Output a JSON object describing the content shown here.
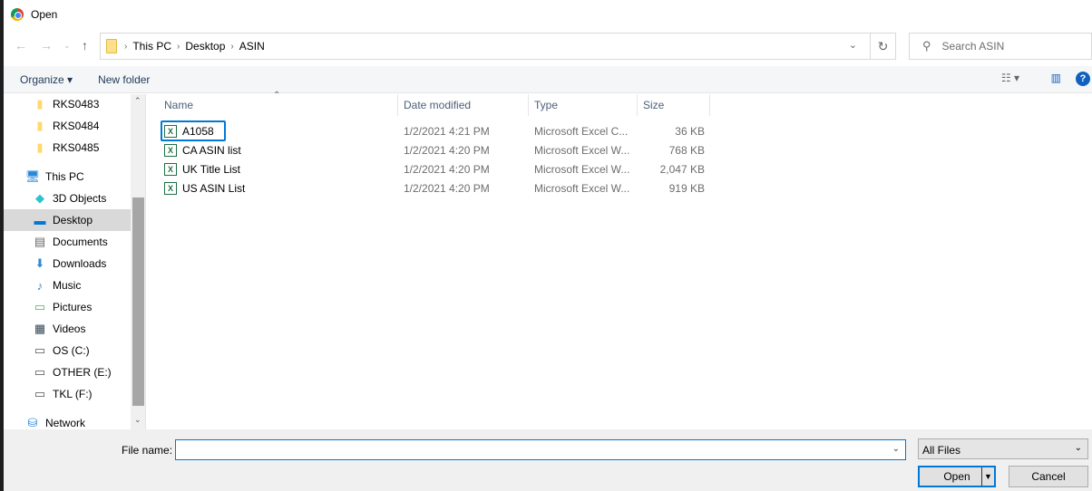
{
  "window": {
    "title": "Open"
  },
  "nav": {
    "breadcrumb": [
      "This PC",
      "Desktop",
      "ASIN"
    ],
    "search_placeholder": "Search ASIN"
  },
  "toolbar": {
    "organize": "Organize",
    "new_folder": "New folder"
  },
  "sidebar": {
    "items": [
      {
        "label": "RKS0483",
        "icon": "folder-icon"
      },
      {
        "label": "RKS0484",
        "icon": "folder-icon"
      },
      {
        "label": "RKS0485",
        "icon": "folder-icon"
      },
      {
        "label": "This PC",
        "icon": "computer-icon"
      },
      {
        "label": "3D Objects",
        "icon": "cube-icon"
      },
      {
        "label": "Desktop",
        "icon": "desktop-icon"
      },
      {
        "label": "Documents",
        "icon": "document-icon"
      },
      {
        "label": "Downloads",
        "icon": "download-icon"
      },
      {
        "label": "Music",
        "icon": "music-icon"
      },
      {
        "label": "Pictures",
        "icon": "picture-icon"
      },
      {
        "label": "Videos",
        "icon": "video-icon"
      },
      {
        "label": "OS (C:)",
        "icon": "drive-icon"
      },
      {
        "label": "OTHER (E:)",
        "icon": "drive-icon"
      },
      {
        "label": "TKL (F:)",
        "icon": "drive-icon"
      },
      {
        "label": "Network",
        "icon": "network-icon"
      }
    ]
  },
  "columns": [
    "Name",
    "Date modified",
    "Type",
    "Size"
  ],
  "files": [
    {
      "name": "A1058",
      "date": "1/2/2021 4:21 PM",
      "type": "Microsoft Excel C...",
      "size": "36 KB"
    },
    {
      "name": "CA ASIN list",
      "date": "1/2/2021 4:20 PM",
      "type": "Microsoft Excel W...",
      "size": "768 KB"
    },
    {
      "name": "UK Title List",
      "date": "1/2/2021 4:20 PM",
      "type": "Microsoft Excel W...",
      "size": "2,047 KB"
    },
    {
      "name": "US ASIN List",
      "date": "1/2/2021 4:20 PM",
      "type": "Microsoft Excel W...",
      "size": "919 KB"
    }
  ],
  "bottom": {
    "file_name_label": "File name:",
    "file_name_value": "",
    "filter": "All Files",
    "open": "Open",
    "cancel": "Cancel"
  }
}
